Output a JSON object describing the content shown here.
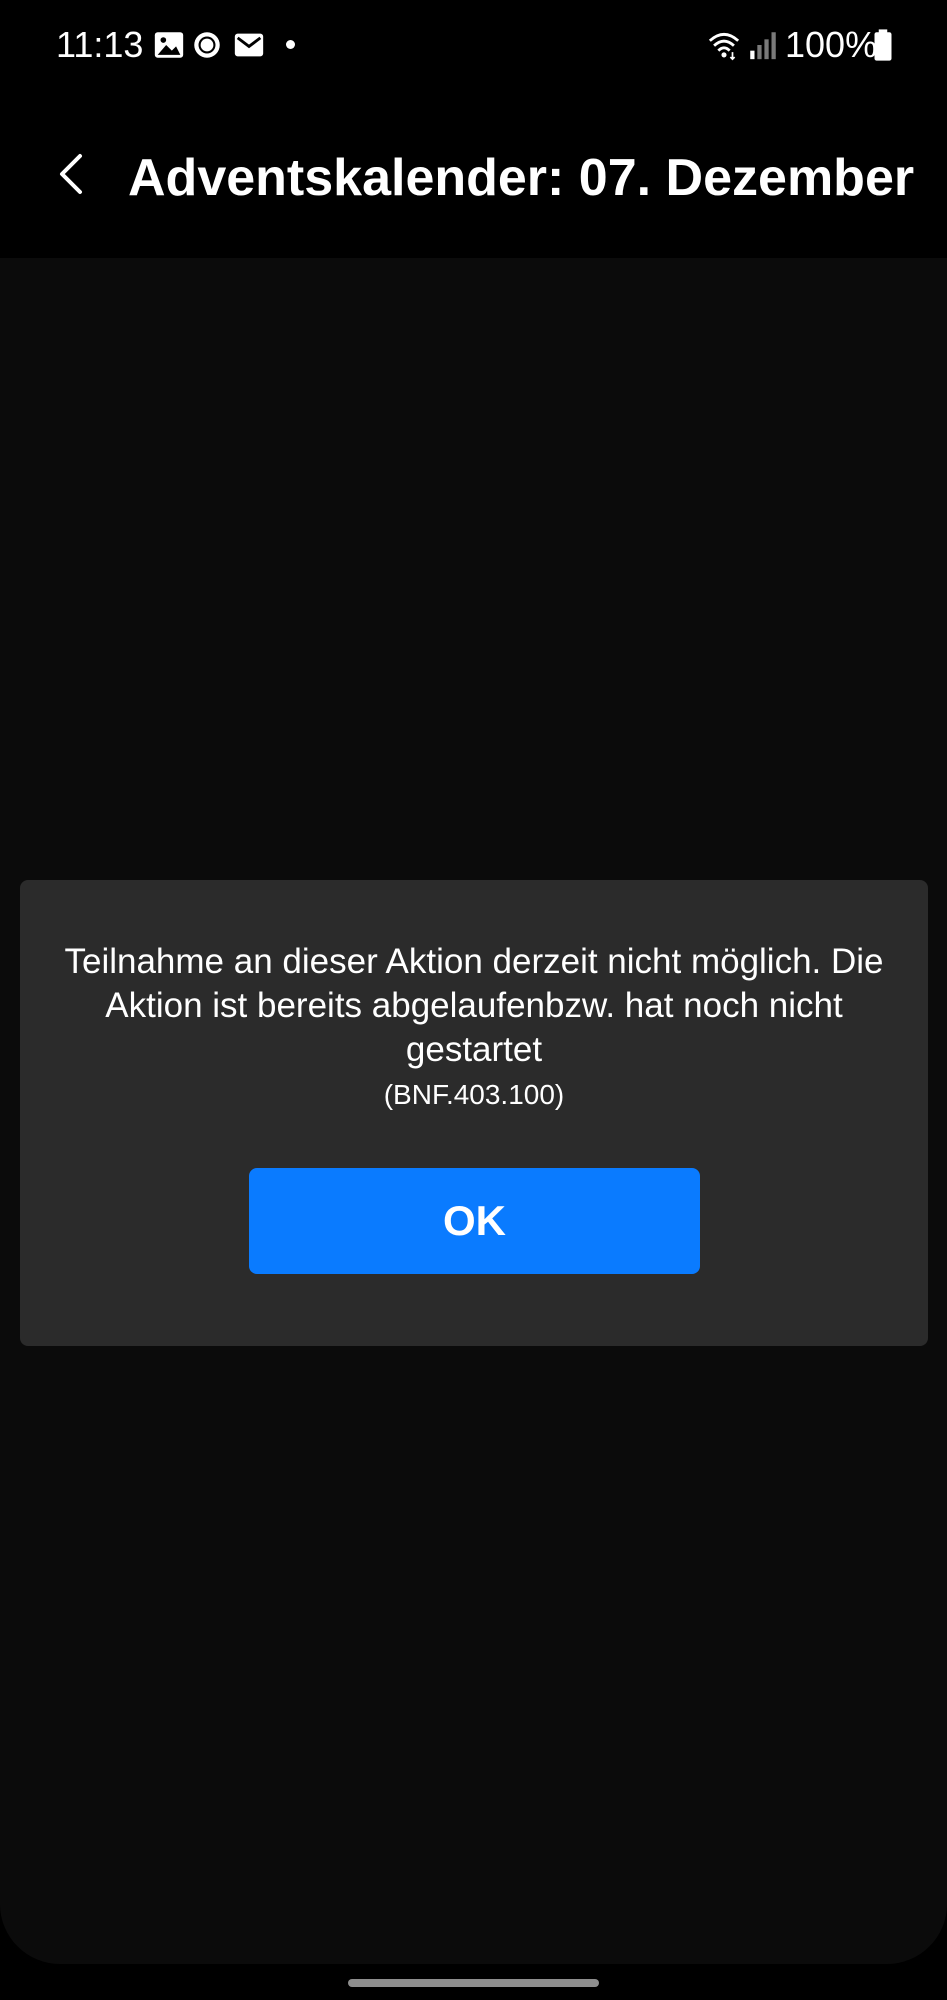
{
  "status_bar": {
    "time": "11:13",
    "battery": "100%",
    "icons": [
      "image-icon",
      "brightness-icon",
      "mail-icon",
      "notification-dot-icon",
      "wifi-icon",
      "signal-icon",
      "battery-icon"
    ]
  },
  "app_bar": {
    "title": "Adventskalender: 07. Dezember",
    "back_icon": "chevron-left-icon"
  },
  "dialog": {
    "message": "Teilnahme an dieser Aktion derzeit nicht möglich. Die Aktion ist bereits abgelaufenbzw. hat noch nicht gestartet",
    "code": "(BNF.403.100)",
    "ok_label": "OK"
  },
  "colors": {
    "background": "#000000",
    "content_background": "#0b0b0b",
    "dialog_background": "#2b2b2b",
    "accent": "#0a7bff"
  }
}
